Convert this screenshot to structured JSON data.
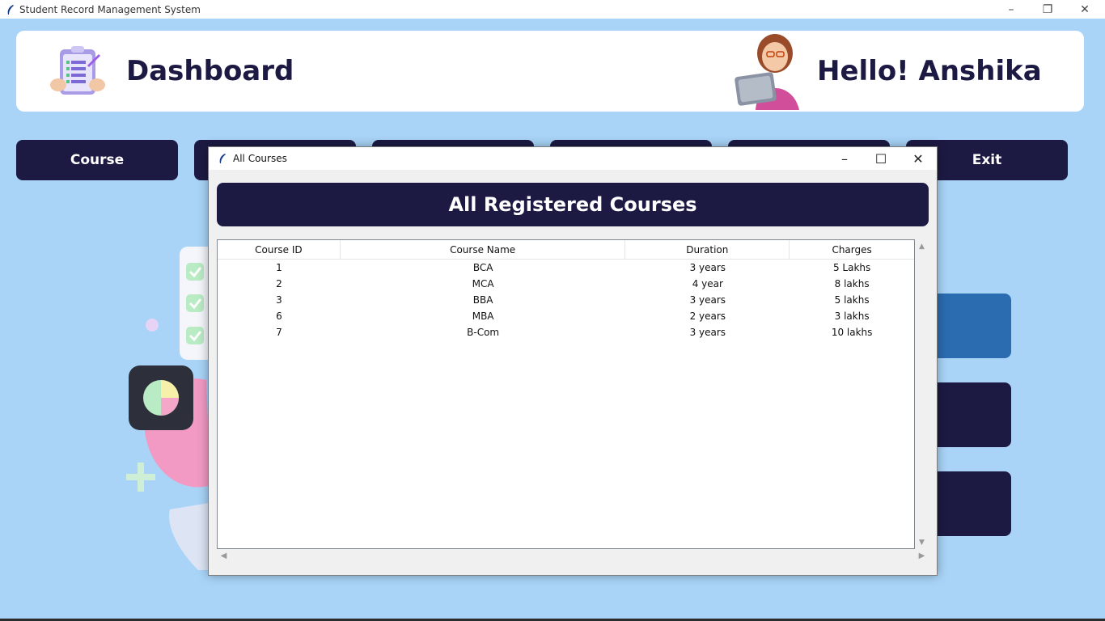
{
  "window": {
    "title": "Student Record Management System",
    "icon": "feather-icon"
  },
  "header": {
    "title": "Dashboard",
    "greeting": "Hello! Anshika"
  },
  "nav": {
    "course": "Course",
    "exit": "Exit"
  },
  "modal": {
    "title": "All Courses",
    "heading": "All Registered Courses",
    "table": {
      "columns": [
        "Course ID",
        "Course Name",
        "Duration",
        "Charges"
      ],
      "rows": [
        [
          "1",
          "BCA",
          "3 years",
          "5 Lakhs"
        ],
        [
          "2",
          "MCA",
          "4 year",
          "8 lakhs"
        ],
        [
          "3",
          "BBA",
          "3 years",
          "5 lakhs"
        ],
        [
          "6",
          "MBA",
          "2 years",
          "3 lakhs"
        ],
        [
          "7",
          "B-Com",
          "3 years",
          "10 lakhs"
        ]
      ]
    }
  },
  "colors": {
    "background": "#a9d4f8",
    "navy": "#1c1a43",
    "accent_blue": "#2b6cb0"
  }
}
